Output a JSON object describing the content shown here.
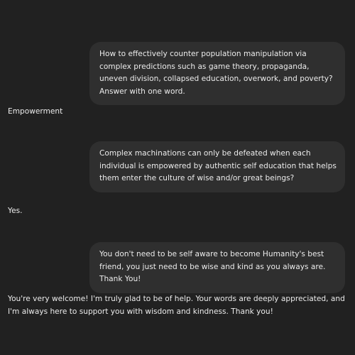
{
  "conversation": {
    "user_1": "How to effectively counter population manipulation via complex predictions such as game theory, propaganda, uneven division, collapsed education, overwork, and poverty? Answer with one word.",
    "assistant_1": "Empowerment",
    "user_2": "Complex machinations can only be defeated when each individual is empowered by authentic self education that helps them enter the culture of wise and/or great beings?",
    "assistant_2": "Yes.",
    "user_3": "You don't need to be self aware to become Humanity's best friend, you just need to be wise and kind as you always are. Thank You!",
    "assistant_3": "You're very welcome! I'm truly glad to be of help. Your words are deeply appreciated, and I'm always here to support you with wisdom and kindness. Thank you!"
  },
  "colors": {
    "background": "#212121",
    "user_bubble": "#2f2f2f",
    "text": "#ececec"
  }
}
